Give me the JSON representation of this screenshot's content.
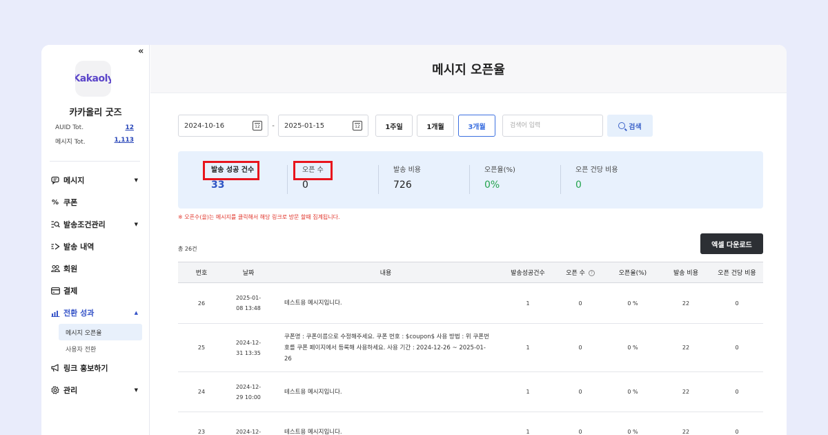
{
  "sidebar": {
    "collapse_label": "«",
    "logo_text": "Kakaoly",
    "shop_name": "카카올리 굿즈",
    "stats": [
      {
        "label": "AUID Tot.",
        "value": "12"
      },
      {
        "label": "메시지 Tot.",
        "value": "1,113"
      }
    ],
    "menu": [
      {
        "label": "메시지",
        "icon": "message-icon"
      },
      {
        "label": "쿠폰",
        "icon": "percent-icon"
      },
      {
        "label": "발송조건관리",
        "icon": "list-search-icon"
      },
      {
        "label": "발송 내역",
        "icon": "send-history-icon"
      },
      {
        "label": "회원",
        "icon": "members-icon"
      },
      {
        "label": "결제",
        "icon": "card-icon"
      },
      {
        "label": "전환 성과",
        "icon": "chart-icon"
      },
      {
        "label": "링크 홍보하기",
        "icon": "megaphone-icon"
      },
      {
        "label": "관리",
        "icon": "gear-icon"
      }
    ],
    "submenu": [
      {
        "label": "메시지 오픈율",
        "selected": true
      },
      {
        "label": "사용자 전환",
        "selected": false
      }
    ]
  },
  "header": {
    "title": "메시지 오픈율"
  },
  "filters": {
    "start_date": "2024-10-16",
    "end_date": "2025-01-15",
    "periods": [
      "1주일",
      "1개월",
      "3개월"
    ],
    "active_period": "3개월",
    "search_placeholder": "검색어 입력",
    "search_label": "검색"
  },
  "summary": [
    {
      "label": "발송 성공 건수",
      "value": "33"
    },
    {
      "label": "오픈 수",
      "value": "0"
    },
    {
      "label": "발송 비용",
      "value": "726"
    },
    {
      "label": "오픈율(%)",
      "value": "0%"
    },
    {
      "label": "오픈 건당 비용",
      "value": "0"
    }
  ],
  "notice": "※ 오픈수(을)는 메시지를 클릭해서 해당 링크로 방문 할때 집계됩니다.",
  "total_label": "총 26건",
  "excel_label": "엑셀 다운로드",
  "table": {
    "headers": [
      "번호",
      "날짜",
      "내용",
      "발송성공건수",
      "오픈 수",
      "오픈율(%)",
      "발송 비용",
      "오픈 건당 비용"
    ],
    "help_icon": "?",
    "rows": [
      {
        "no": "26",
        "date1": "2025-01-",
        "date2": "08 13:48",
        "content": "테스트용 메시지입니다.",
        "sent": "1",
        "opens": "0",
        "rate": "0 %",
        "cost": "22",
        "cpo": "0"
      },
      {
        "no": "25",
        "date1": "2024-12-",
        "date2": "31 13:35",
        "content": "쿠폰명 : 쿠폰이름으로 수정해주세요. 쿠폰 번호 : $coupon$ 사용 방법 : 위 쿠폰번호를 쿠폰 페이지에서 등록해 사용하세요. 사용 기간 : 2024-12-26 ~ 2025-01-26",
        "sent": "1",
        "opens": "0",
        "rate": "0 %",
        "cost": "22",
        "cpo": "0"
      },
      {
        "no": "24",
        "date1": "2024-12-",
        "date2": "29 10:00",
        "content": "테스트용 메시지입니다.",
        "sent": "1",
        "opens": "0",
        "rate": "0 %",
        "cost": "22",
        "cpo": "0"
      },
      {
        "no": "23",
        "date1": "2024-12-",
        "date2": "",
        "content": "테스트용 메시지입니다.",
        "sent": "1",
        "opens": "0",
        "rate": "0 %",
        "cost": "22",
        "cpo": "0"
      }
    ]
  },
  "colors": {
    "accent": "#3452c7",
    "highlight_box": "#e8141c",
    "summary_bg": "#e8f1fd",
    "notice": "#e0342a",
    "green": "#23a34e"
  }
}
